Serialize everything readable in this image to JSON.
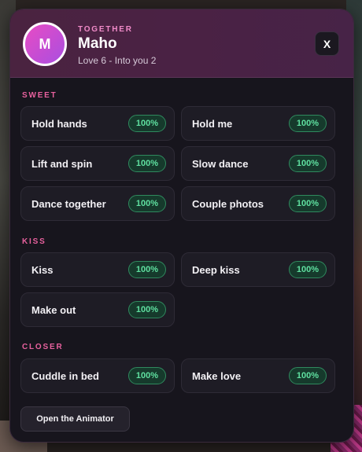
{
  "header": {
    "avatar_letter": "M",
    "kicker": "TOGETHER",
    "name": "Maho",
    "status": "Love 6 - Into you 2",
    "close_label": "X"
  },
  "sections": [
    {
      "title": "SWEET",
      "items": [
        {
          "label": "Hold hands",
          "value": "100%"
        },
        {
          "label": "Hold me",
          "value": "100%"
        },
        {
          "label": "Lift and spin",
          "value": "100%"
        },
        {
          "label": "Slow dance",
          "value": "100%"
        },
        {
          "label": "Dance together",
          "value": "100%"
        },
        {
          "label": "Couple photos",
          "value": "100%"
        }
      ]
    },
    {
      "title": "KISS",
      "items": [
        {
          "label": "Kiss",
          "value": "100%"
        },
        {
          "label": "Deep kiss",
          "value": "100%"
        },
        {
          "label": "Make out",
          "value": "100%"
        }
      ]
    },
    {
      "title": "CLOSER",
      "items": [
        {
          "label": "Cuddle in bed",
          "value": "100%"
        },
        {
          "label": "Make love",
          "value": "100%"
        }
      ]
    }
  ],
  "footer": {
    "animator_label": "Open the Animator"
  },
  "colors": {
    "accent_pink": "#e8619e",
    "badge_green": "#5fe0a0",
    "panel_bg": "#17151d"
  }
}
